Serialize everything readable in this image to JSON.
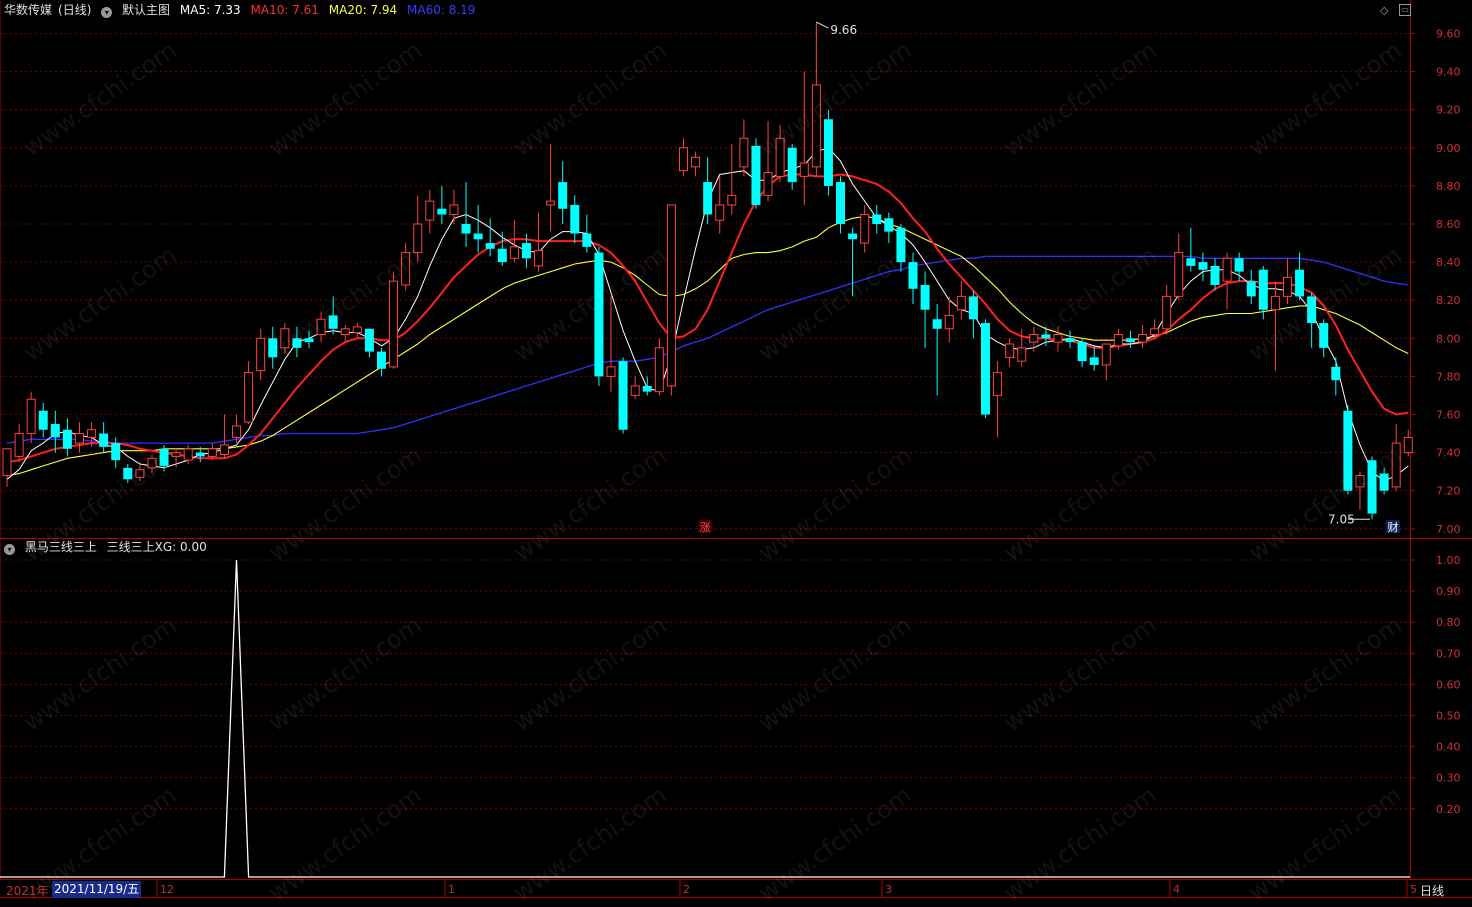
{
  "header": {
    "stock_name": "华数传媒",
    "period_tag": "(日线)",
    "main_chart_label": "默认主图",
    "ma": [
      {
        "label": "MA5: 7.33",
        "color": "#ffffff"
      },
      {
        "label": "MA10: 7.61",
        "color": "#ff2020"
      },
      {
        "label": "MA20: 7.94",
        "color": "#ffff40"
      },
      {
        "label": "MA60: 8.19",
        "color": "#3030ff"
      }
    ]
  },
  "sub_header": {
    "label": "黑马三线三上",
    "value_label": "三线三上XG: 0.00"
  },
  "price_axis": {
    "ticks": [
      "9.60",
      "9.40",
      "9.20",
      "9.00",
      "8.80",
      "8.60",
      "8.40",
      "8.20",
      "8.00",
      "7.80",
      "7.60",
      "7.40",
      "7.20",
      "7.00"
    ],
    "high_label": "9.66",
    "low_label": "7.05"
  },
  "indicator_axis": {
    "ticks": [
      "1.00",
      "0.90",
      "0.80",
      "0.70",
      "0.60",
      "0.50",
      "0.40",
      "0.30",
      "0.20"
    ]
  },
  "time_axis": {
    "year_label": "2021年",
    "cursor_date": "2021/11/19/五",
    "month_labels": [
      "12",
      "1",
      "2",
      "3",
      "4",
      "5"
    ]
  },
  "markers": {
    "zhang": "涨",
    "cai": "财"
  },
  "period_button": "日线",
  "watermark": "www.cfchi.com",
  "colors": {
    "up": "#ff4040",
    "down": "#00ffff",
    "ma5": "#ffffff",
    "ma10": "#ff2020",
    "ma20": "#ffff40",
    "ma60": "#3030ff",
    "axis": "#b00000",
    "grid": "#8a0000"
  },
  "chart_data": {
    "type": "candlestick",
    "y_range": [
      6.93,
      9.71
    ],
    "candles": [
      [
        7.28,
        7.42,
        7.42,
        7.22
      ],
      [
        7.38,
        7.5,
        7.55,
        7.35
      ],
      [
        7.5,
        7.68,
        7.72,
        7.45
      ],
      [
        7.62,
        7.52,
        7.66,
        7.48
      ],
      [
        7.55,
        7.48,
        7.62,
        7.4
      ],
      [
        7.52,
        7.42,
        7.58,
        7.38
      ],
      [
        7.45,
        7.5,
        7.56,
        7.4
      ],
      [
        7.48,
        7.52,
        7.56,
        7.43
      ],
      [
        7.5,
        7.43,
        7.56,
        7.4
      ],
      [
        7.45,
        7.36,
        7.48,
        7.32
      ],
      [
        7.32,
        7.26,
        7.34,
        7.24
      ],
      [
        7.27,
        7.31,
        7.35,
        7.25
      ],
      [
        7.32,
        7.37,
        7.39,
        7.29
      ],
      [
        7.42,
        7.33,
        7.44,
        7.3
      ],
      [
        7.38,
        7.4,
        7.42,
        7.32
      ],
      [
        7.36,
        7.42,
        7.44,
        7.34
      ],
      [
        7.4,
        7.38,
        7.43,
        7.35
      ],
      [
        7.38,
        7.42,
        7.45,
        7.36
      ],
      [
        7.39,
        7.44,
        7.6,
        7.37
      ],
      [
        7.48,
        7.54,
        7.6,
        7.45
      ],
      [
        7.56,
        7.82,
        7.88,
        7.55
      ],
      [
        7.83,
        8.0,
        8.05,
        7.78
      ],
      [
        8.0,
        7.9,
        8.06,
        7.84
      ],
      [
        7.95,
        8.05,
        8.08,
        7.92
      ],
      [
        8.0,
        7.95,
        8.06,
        7.9
      ],
      [
        8.0,
        7.98,
        8.04,
        7.95
      ],
      [
        8.02,
        8.1,
        8.14,
        7.98
      ],
      [
        8.12,
        8.05,
        8.22,
        8.02
      ],
      [
        8.02,
        8.05,
        8.07,
        7.98
      ],
      [
        8.03,
        8.06,
        8.08,
        8.0
      ],
      [
        8.05,
        7.93,
        8.05,
        7.9
      ],
      [
        7.93,
        7.84,
        7.95,
        7.8
      ],
      [
        7.85,
        8.3,
        8.35,
        7.84
      ],
      [
        8.28,
        8.45,
        8.5,
        8.25
      ],
      [
        8.45,
        8.6,
        8.75,
        8.4
      ],
      [
        8.62,
        8.72,
        8.78,
        8.55
      ],
      [
        8.68,
        8.65,
        8.8,
        8.6
      ],
      [
        8.65,
        8.7,
        8.78,
        8.6
      ],
      [
        8.6,
        8.55,
        8.82,
        8.48
      ],
      [
        8.55,
        8.52,
        8.7,
        8.45
      ],
      [
        8.5,
        8.47,
        8.63,
        8.43
      ],
      [
        8.47,
        8.4,
        8.56,
        8.38
      ],
      [
        8.42,
        8.48,
        8.62,
        8.4
      ],
      [
        8.5,
        8.42,
        8.55,
        8.37
      ],
      [
        8.38,
        8.46,
        8.66,
        8.35
      ],
      [
        8.7,
        8.72,
        9.02,
        8.56
      ],
      [
        8.82,
        8.68,
        8.93,
        8.6
      ],
      [
        8.7,
        8.55,
        8.75,
        8.5
      ],
      [
        8.55,
        8.48,
        8.65,
        8.45
      ],
      [
        8.45,
        7.8,
        8.48,
        7.75
      ],
      [
        7.8,
        7.85,
        8.22,
        7.72
      ],
      [
        7.88,
        7.52,
        7.9,
        7.5
      ],
      [
        7.7,
        7.75,
        7.8,
        7.68
      ],
      [
        7.75,
        7.72,
        7.8,
        7.7
      ],
      [
        7.72,
        7.95,
        8.0,
        7.7
      ],
      [
        7.75,
        8.7,
        8.7,
        7.7
      ],
      [
        8.88,
        9.0,
        9.05,
        8.85
      ],
      [
        8.9,
        8.95,
        8.98,
        8.85
      ],
      [
        8.82,
        8.65,
        8.95,
        8.6
      ],
      [
        8.62,
        8.7,
        8.85,
        8.55
      ],
      [
        8.7,
        8.75,
        9.02,
        8.65
      ],
      [
        8.9,
        9.05,
        9.15,
        8.85
      ],
      [
        9.01,
        8.7,
        9.05,
        8.68
      ],
      [
        8.75,
        8.87,
        9.14,
        8.72
      ],
      [
        8.85,
        9.05,
        9.12,
        8.82
      ],
      [
        9.0,
        8.82,
        9.02,
        8.78
      ],
      [
        8.85,
        8.92,
        9.4,
        8.7
      ],
      [
        8.9,
        9.33,
        9.66,
        8.85
      ],
      [
        9.15,
        8.8,
        9.2,
        8.75
      ],
      [
        8.82,
        8.6,
        8.85,
        8.55
      ],
      [
        8.55,
        8.52,
        8.58,
        8.22
      ],
      [
        8.5,
        8.65,
        8.7,
        8.45
      ],
      [
        8.65,
        8.6,
        8.7,
        8.55
      ],
      [
        8.63,
        8.56,
        8.66,
        8.5
      ],
      [
        8.58,
        8.4,
        8.6,
        8.35
      ],
      [
        8.4,
        8.26,
        8.45,
        8.18
      ],
      [
        8.28,
        8.15,
        8.35,
        7.95
      ],
      [
        8.1,
        8.05,
        8.18,
        7.7
      ],
      [
        8.05,
        8.12,
        8.22,
        7.98
      ],
      [
        8.15,
        8.22,
        8.3,
        8.1
      ],
      [
        8.22,
        8.1,
        8.25,
        8.0
      ],
      [
        8.08,
        7.6,
        8.1,
        7.58
      ],
      [
        7.7,
        7.82,
        7.88,
        7.48
      ],
      [
        7.9,
        7.97,
        8.0,
        7.85
      ],
      [
        7.88,
        7.95,
        8.05,
        7.85
      ],
      [
        7.98,
        8.02,
        8.06,
        7.93
      ],
      [
        8.02,
        8.0,
        8.06,
        7.96
      ],
      [
        7.98,
        8.02,
        8.06,
        7.93
      ],
      [
        8.0,
        7.98,
        8.04,
        7.95
      ],
      [
        7.98,
        7.88,
        8.0,
        7.85
      ],
      [
        7.9,
        7.86,
        7.96,
        7.83
      ],
      [
        7.86,
        7.97,
        7.97,
        7.78
      ],
      [
        7.96,
        8.02,
        8.05,
        7.94
      ],
      [
        8.0,
        7.98,
        8.04,
        7.95
      ],
      [
        7.98,
        8.02,
        8.07,
        7.95
      ],
      [
        8.02,
        8.05,
        8.1,
        8.0
      ],
      [
        8.05,
        8.22,
        8.28,
        8.02
      ],
      [
        8.22,
        8.45,
        8.55,
        8.2
      ],
      [
        8.42,
        8.38,
        8.58,
        8.35
      ],
      [
        8.4,
        8.36,
        8.45,
        8.3
      ],
      [
        8.38,
        8.28,
        8.42,
        8.25
      ],
      [
        8.3,
        8.42,
        8.45,
        8.15
      ],
      [
        8.42,
        8.35,
        8.45,
        8.3
      ],
      [
        8.3,
        8.22,
        8.36,
        8.18
      ],
      [
        8.36,
        8.15,
        8.38,
        8.1
      ],
      [
        8.15,
        8.22,
        8.3,
        7.83
      ],
      [
        8.22,
        8.32,
        8.42,
        8.18
      ],
      [
        8.36,
        8.22,
        8.45,
        8.2
      ],
      [
        8.22,
        8.08,
        8.24,
        7.95
      ],
      [
        8.08,
        7.95,
        8.1,
        7.9
      ],
      [
        7.85,
        7.78,
        7.9,
        7.7
      ],
      [
        7.62,
        7.2,
        7.65,
        7.18
      ],
      [
        7.22,
        7.28,
        7.3,
        7.1
      ],
      [
        7.36,
        7.08,
        7.38,
        7.05
      ],
      [
        7.29,
        7.2,
        7.32,
        7.18
      ],
      [
        7.22,
        7.45,
        7.55,
        7.2
      ],
      [
        7.4,
        7.48,
        7.52,
        7.38
      ]
    ],
    "ma5": [
      7.26,
      7.31,
      7.41,
      7.45,
      7.5,
      7.51,
      7.49,
      7.48,
      7.44,
      7.43,
      7.38,
      7.34,
      7.33,
      7.32,
      7.34,
      7.36,
      7.39,
      7.4,
      7.42,
      7.44,
      7.52,
      7.65,
      7.77,
      7.89,
      7.98,
      8.0,
      8.03,
      8.04,
      8.03,
      8.03,
      8.0,
      7.96,
      8.0,
      8.1,
      8.22,
      8.38,
      8.52,
      8.63,
      8.65,
      8.62,
      8.58,
      8.53,
      8.49,
      8.46,
      8.45,
      8.52,
      8.56,
      8.56,
      8.55,
      8.44,
      8.24,
      8.04,
      7.88,
      7.74,
      7.72,
      7.91,
      8.2,
      8.47,
      8.72,
      8.86,
      8.87,
      8.88,
      8.83,
      8.83,
      8.87,
      8.89,
      8.91,
      8.98,
      9.0,
      8.93,
      8.81,
      8.72,
      8.63,
      8.59,
      8.55,
      8.49,
      8.4,
      8.3,
      8.2,
      8.15,
      8.13,
      8.02,
      7.98,
      7.95,
      7.94,
      7.95,
      7.98,
      7.99,
      8.0,
      7.98,
      7.96,
      7.95,
      7.97,
      7.97,
      7.98,
      8.02,
      8.13,
      8.23,
      8.3,
      8.35,
      8.36,
      8.36,
      8.33,
      8.28,
      8.26,
      8.26,
      8.25,
      8.22,
      8.14,
      8.0,
      7.88,
      7.62,
      7.44,
      7.3,
      7.25,
      7.28,
      7.33
    ],
    "ma10": [
      7.35,
      7.36,
      7.38,
      7.4,
      7.42,
      7.43,
      7.44,
      7.45,
      7.45,
      7.45,
      7.44,
      7.42,
      7.41,
      7.4,
      7.39,
      7.38,
      7.37,
      7.37,
      7.37,
      7.39,
      7.44,
      7.5,
      7.58,
      7.66,
      7.74,
      7.81,
      7.88,
      7.94,
      7.98,
      8.0,
      8.0,
      7.99,
      7.99,
      8.03,
      8.09,
      8.16,
      8.24,
      8.32,
      8.38,
      8.44,
      8.48,
      8.51,
      8.52,
      8.52,
      8.51,
      8.51,
      8.51,
      8.51,
      8.51,
      8.49,
      8.45,
      8.38,
      8.3,
      8.19,
      8.08,
      8.0,
      8.01,
      8.05,
      8.15,
      8.3,
      8.45,
      8.6,
      8.72,
      8.8,
      8.85,
      8.86,
      8.86,
      8.85,
      8.85,
      8.86,
      8.85,
      8.83,
      8.81,
      8.77,
      8.71,
      8.63,
      8.56,
      8.47,
      8.39,
      8.32,
      8.25,
      8.18,
      8.1,
      8.04,
      8.01,
      8.0,
      8.0,
      7.99,
      7.99,
      7.97,
      7.95,
      7.95,
      7.96,
      7.97,
      7.98,
      8.0,
      8.04,
      8.1,
      8.15,
      8.21,
      8.26,
      8.29,
      8.3,
      8.3,
      8.29,
      8.29,
      8.29,
      8.27,
      8.24,
      8.17,
      8.07,
      7.94,
      7.83,
      7.72,
      7.63,
      7.6,
      7.61
    ],
    "ma20": [
      7.28,
      7.29,
      7.31,
      7.33,
      7.35,
      7.37,
      7.38,
      7.39,
      7.4,
      7.41,
      7.41,
      7.41,
      7.41,
      7.42,
      7.42,
      7.42,
      7.42,
      7.42,
      7.42,
      7.43,
      7.44,
      7.46,
      7.49,
      7.53,
      7.57,
      7.61,
      7.65,
      7.69,
      7.73,
      7.77,
      7.81,
      7.85,
      7.89,
      7.93,
      7.97,
      8.02,
      8.06,
      8.1,
      8.14,
      8.18,
      8.22,
      8.26,
      8.29,
      8.31,
      8.33,
      8.35,
      8.37,
      8.39,
      8.4,
      8.41,
      8.4,
      8.37,
      8.33,
      8.28,
      8.23,
      8.22,
      8.23,
      8.26,
      8.3,
      8.36,
      8.42,
      8.44,
      8.45,
      8.45,
      8.46,
      8.48,
      8.51,
      8.53,
      8.58,
      8.61,
      8.63,
      8.64,
      8.63,
      8.6,
      8.58,
      8.55,
      8.52,
      8.49,
      8.46,
      8.43,
      8.38,
      8.32,
      8.26,
      8.19,
      8.13,
      8.08,
      8.05,
      8.03,
      8.01,
      8.0,
      7.99,
      7.99,
      7.99,
      7.99,
      8.0,
      8.01,
      8.03,
      8.06,
      8.09,
      8.11,
      8.12,
      8.13,
      8.13,
      8.13,
      8.14,
      8.15,
      8.16,
      8.17,
      8.17,
      8.15,
      8.13,
      8.1,
      8.07,
      8.03,
      7.99,
      7.95,
      7.92
    ],
    "ma60": [
      7.45,
      7.46,
      7.47,
      7.47,
      7.47,
      7.47,
      7.47,
      7.46,
      7.46,
      7.45,
      7.45,
      7.45,
      7.45,
      7.45,
      7.45,
      7.45,
      7.45,
      7.45,
      7.46,
      7.47,
      7.48,
      7.49,
      7.49,
      7.5,
      7.5,
      7.5,
      7.5,
      7.5,
      7.5,
      7.5,
      7.51,
      7.52,
      7.53,
      7.55,
      7.57,
      7.59,
      7.61,
      7.63,
      7.65,
      7.67,
      7.69,
      7.71,
      7.73,
      7.75,
      7.77,
      7.79,
      7.81,
      7.83,
      7.85,
      7.87,
      7.88,
      7.88,
      7.88,
      7.89,
      7.9,
      7.93,
      7.96,
      7.98,
      8.0,
      8.03,
      8.06,
      8.09,
      8.12,
      8.15,
      8.17,
      8.19,
      8.21,
      8.23,
      8.25,
      8.27,
      8.29,
      8.31,
      8.33,
      8.35,
      8.36,
      8.38,
      8.39,
      8.4,
      8.41,
      8.42,
      8.42,
      8.43,
      8.43,
      8.43,
      8.43,
      8.43,
      8.43,
      8.43,
      8.43,
      8.43,
      8.43,
      8.43,
      8.43,
      8.43,
      8.43,
      8.43,
      8.43,
      8.43,
      8.43,
      8.42,
      8.42,
      8.42,
      8.42,
      8.42,
      8.42,
      8.42,
      8.42,
      8.42,
      8.41,
      8.4,
      8.38,
      8.36,
      8.34,
      8.32,
      8.3,
      8.29,
      8.28
    ],
    "indicator": {
      "name": "三线三上XG",
      "y_range": [
        0,
        1
      ],
      "signal_index": 19,
      "signal_value": 1.0,
      "baseline": 0.0
    }
  }
}
